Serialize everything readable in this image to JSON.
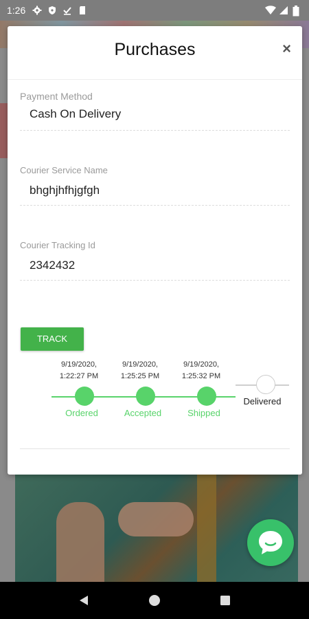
{
  "status_bar": {
    "time": "1:26",
    "left_icons": [
      "gear-icon",
      "shield-icon",
      "download-done-icon",
      "sd-card-icon"
    ],
    "right_icons": [
      "wifi-icon",
      "signal-icon",
      "battery-icon"
    ]
  },
  "modal": {
    "title": "Purchases",
    "close_label": "×",
    "fields": [
      {
        "label": "Payment Method",
        "value": "Cash On Delivery"
      },
      {
        "label": "Courier Service Name",
        "value": "bhghjhfhjgfgh"
      },
      {
        "label": "Courier Tracking Id",
        "value": "2342432"
      }
    ],
    "track_button": "TRACK",
    "timeline": [
      {
        "date": "9/19/2020,",
        "time": "1:22:27 PM",
        "label": "Ordered",
        "done": true
      },
      {
        "date": "9/19/2020,",
        "time": "1:25:25 PM",
        "label": "Accepted",
        "done": true
      },
      {
        "date": "9/19/2020,",
        "time": "1:25:32 PM",
        "label": "Shipped",
        "done": true
      },
      {
        "date": "",
        "time": "",
        "label": "Delivered",
        "done": false
      }
    ]
  },
  "colors": {
    "accent_green": "#43b24a",
    "timeline_green": "#58d36a",
    "chat_green": "#38c16a"
  },
  "nav": {
    "buttons": [
      "back-icon",
      "home-icon",
      "recents-icon"
    ]
  }
}
